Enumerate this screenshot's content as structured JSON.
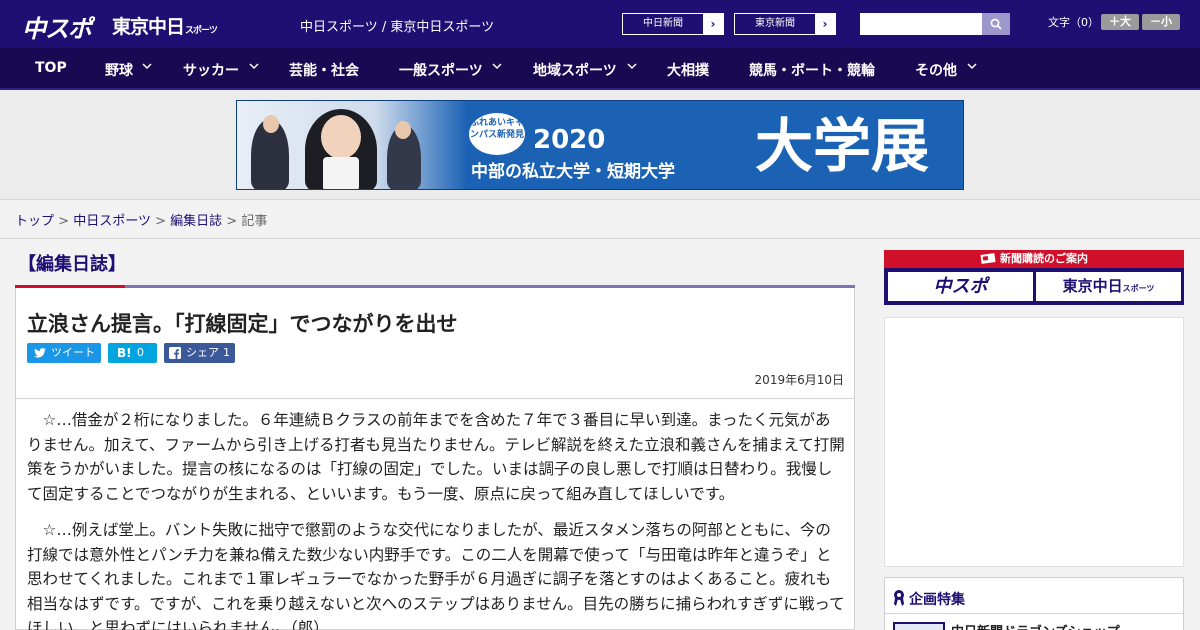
{
  "header": {
    "logo_chuspo": "中スポ",
    "logo_tokyo": "東京中日",
    "logo_tokyo_sub": "スポーツ",
    "site_name": "中日スポーツ / 東京中日スポーツ",
    "paper_links": [
      "中日新聞",
      "東京新聞"
    ],
    "search_placeholder": "",
    "font_size_label": "文字（0）",
    "font_larger": "＋大",
    "font_smaller": "－小"
  },
  "nav": {
    "items": [
      {
        "label": "TOP",
        "has_menu": false
      },
      {
        "label": "野球",
        "has_menu": true
      },
      {
        "label": "サッカー",
        "has_menu": true
      },
      {
        "label": "芸能・社会",
        "has_menu": false
      },
      {
        "label": "一般スポーツ",
        "has_menu": true
      },
      {
        "label": "地域スポーツ",
        "has_menu": true
      },
      {
        "label": "大相撲",
        "has_menu": false
      },
      {
        "label": "競馬・ボート・競輪",
        "has_menu": false
      },
      {
        "label": "その他",
        "has_menu": true
      }
    ]
  },
  "banner": {
    "badge": "ふれあいキャンパス新発見",
    "year": "2020",
    "subtitle": "中部の私立大学・短期大学",
    "big_text": "大学展"
  },
  "breadcrumb": {
    "items": [
      "トップ",
      "中日スポーツ",
      "編集日誌"
    ],
    "current": "記事",
    "separator": ">"
  },
  "section": {
    "title": "【編集日誌】"
  },
  "article": {
    "title": "立浪さん提言。「打線固定」でつながりを出せ",
    "share": {
      "tweet_label": "ツイート",
      "hatena_label": "B!",
      "hatena_count": "0",
      "facebook_label": "シェア",
      "facebook_count": "1"
    },
    "date": "2019年6月10日",
    "paragraphs": [
      "☆…借金が２桁になりました。６年連続Ｂクラスの前年までを含めた７年で３番目に早い到達。まったく元気がありません。加えて、ファームから引き上げる打者も見当たりません。テレビ解説を終えた立浪和義さんを捕まえて打開策をうかがいました。提言の核になるのは「打線の固定」でした。いまは調子の良し悪しで打順は日替わり。我慢して固定することでつながりが生まれる、といいます。もう一度、原点に戻って組み直してほしいです。",
      "☆…例えば堂上。バント失敗に拙守で懲罰のような交代になりましたが、最近スタメン落ちの阿部とともに、今の打線では意外性とパンチ力を兼ね備えた数少ない内野手です。この二人を開幕で使って「与田竜は昨年と違うぞ」と思わせてくれました。これまで１軍レギュラーでなかった野手が６月過ぎに調子を落とすのはよくあること。疲れも相当なはずです。ですが、これを乗り越えないと次へのステップはありません。目先の勝ちに捕らわれすぎずに戦ってほしい、と思わずにはいられません。（郎）"
    ]
  },
  "sidebar": {
    "subscribe_head": "新聞購読のご案内",
    "subscribe_left": "中スポ",
    "subscribe_right": "東京中日",
    "subscribe_right_sub": "スポーツ",
    "feature_title": "企画特集",
    "feature_item": "中日新聞ドラゴンズショップ"
  },
  "colors": {
    "brand_navy": "#1f0f73",
    "nav_dark": "#170a52",
    "accent_red": "#d0102a",
    "twitter": "#1a96e6",
    "hatena": "#00a4de",
    "facebook": "#3b5998"
  }
}
